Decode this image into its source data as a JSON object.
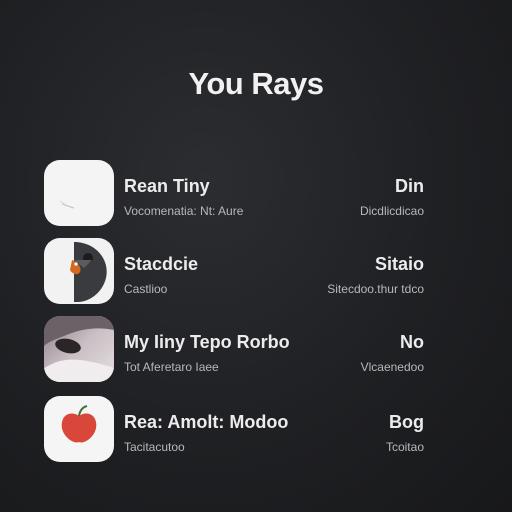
{
  "header": {
    "title": "You Rays"
  },
  "items": [
    {
      "name": "Rean Tiny",
      "subtitle": "Vocomenatia: Nt: Aure",
      "value": "Din",
      "meta": "Dicdlicdicao",
      "icon": "blank-app-icon"
    },
    {
      "name": "Stacdcie",
      "subtitle": "Castlioo",
      "value": "Sitaio",
      "meta": "Sitecdoo.thur tdco",
      "icon": "bird-app-icon"
    },
    {
      "name": "My Iiny Tepo Rorbo",
      "subtitle": "Tot Aferetaro Iaee",
      "value": "No",
      "meta": "Vlcaenedoo",
      "icon": "photo-thumbnail-icon"
    },
    {
      "name": "Rea: Amolt: Modoo",
      "subtitle": "Tacitacutoo",
      "value": "Bog",
      "meta": "Tcoitao",
      "icon": "apple-app-icon"
    }
  ],
  "colors": {
    "background": "#1f2023",
    "text": "#ececee",
    "subtext": "#b7b8bb",
    "accent_red": "#d9473b"
  }
}
